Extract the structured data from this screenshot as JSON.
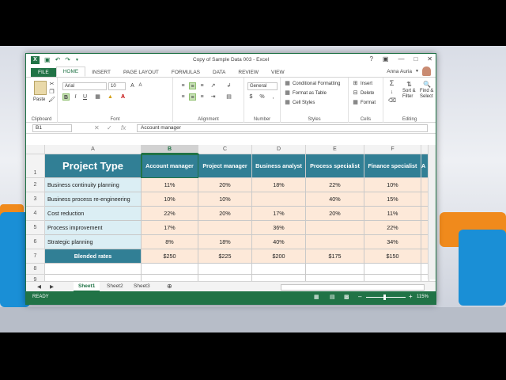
{
  "window": {
    "title": "Copy of Sample Data 003 - Excel",
    "user_name": "Anna Auria",
    "controls": [
      "?",
      "▣",
      "—",
      "□",
      "✕"
    ]
  },
  "quick_access": [
    "X",
    "💾",
    "↶",
    "↷",
    "▼"
  ],
  "ribbon_tabs": [
    "FILE",
    "HOME",
    "INSERT",
    "PAGE LAYOUT",
    "FORMULAS",
    "DATA",
    "REVIEW",
    "VIEW"
  ],
  "ribbon": {
    "clipboard": {
      "label": "Clipboard",
      "paste": "Paste"
    },
    "font": {
      "label": "Font",
      "name": "Arial",
      "size": "10",
      "bold": "B",
      "italic": "I",
      "underline": "U"
    },
    "alignment": {
      "label": "Alignment"
    },
    "number": {
      "label": "Number",
      "format": "General",
      "currency": "$",
      "percent": "%",
      "comma": ","
    },
    "styles": {
      "label": "Styles",
      "conditional": "Conditional Formatting",
      "format_table": "Format as Table",
      "cell_styles": "Cell Styles"
    },
    "cells": {
      "label": "Cells",
      "insert": "Insert",
      "delete": "Delete",
      "format": "Format"
    },
    "editing": {
      "label": "Editing",
      "sigma": "Σ",
      "sort": "Sort &",
      "filter": "Filter",
      "find": "Find &",
      "select": "Select"
    }
  },
  "formula_bar": {
    "name_box": "B1",
    "fx": "fx",
    "content": "Account manager"
  },
  "columns": [
    "A",
    "B",
    "C",
    "D",
    "E",
    "F"
  ],
  "rows": [
    "1",
    "2",
    "3",
    "4",
    "5",
    "6",
    "7",
    "8",
    "9"
  ],
  "table": {
    "title": "Project Type",
    "headers": [
      "Account manager",
      "Project manager",
      "Business analyst",
      "Process specialist",
      "Finance specialist"
    ],
    "overflow_header": "A",
    "rows": [
      {
        "label": "Business continuity planning",
        "values": [
          "11%",
          "20%",
          "18%",
          "22%",
          "10%"
        ]
      },
      {
        "label": "Business process re-engineering",
        "values": [
          "10%",
          "10%",
          "",
          "40%",
          "15%"
        ]
      },
      {
        "label": "Cost reduction",
        "values": [
          "22%",
          "20%",
          "17%",
          "20%",
          "11%"
        ]
      },
      {
        "label": "Process improvement",
        "values": [
          "17%",
          "",
          "36%",
          "",
          "22%"
        ]
      },
      {
        "label": "Strategic planning",
        "values": [
          "8%",
          "18%",
          "40%",
          "",
          "34%"
        ]
      }
    ],
    "blended": {
      "label": "Blended rates",
      "values": [
        "$250",
        "$225",
        "$200",
        "$175",
        "$150"
      ]
    }
  },
  "sheets": [
    "Sheet1",
    "Sheet2",
    "Sheet3"
  ],
  "add_sheet": "⊕",
  "status": {
    "mode": "READY",
    "zoom": "115%"
  }
}
